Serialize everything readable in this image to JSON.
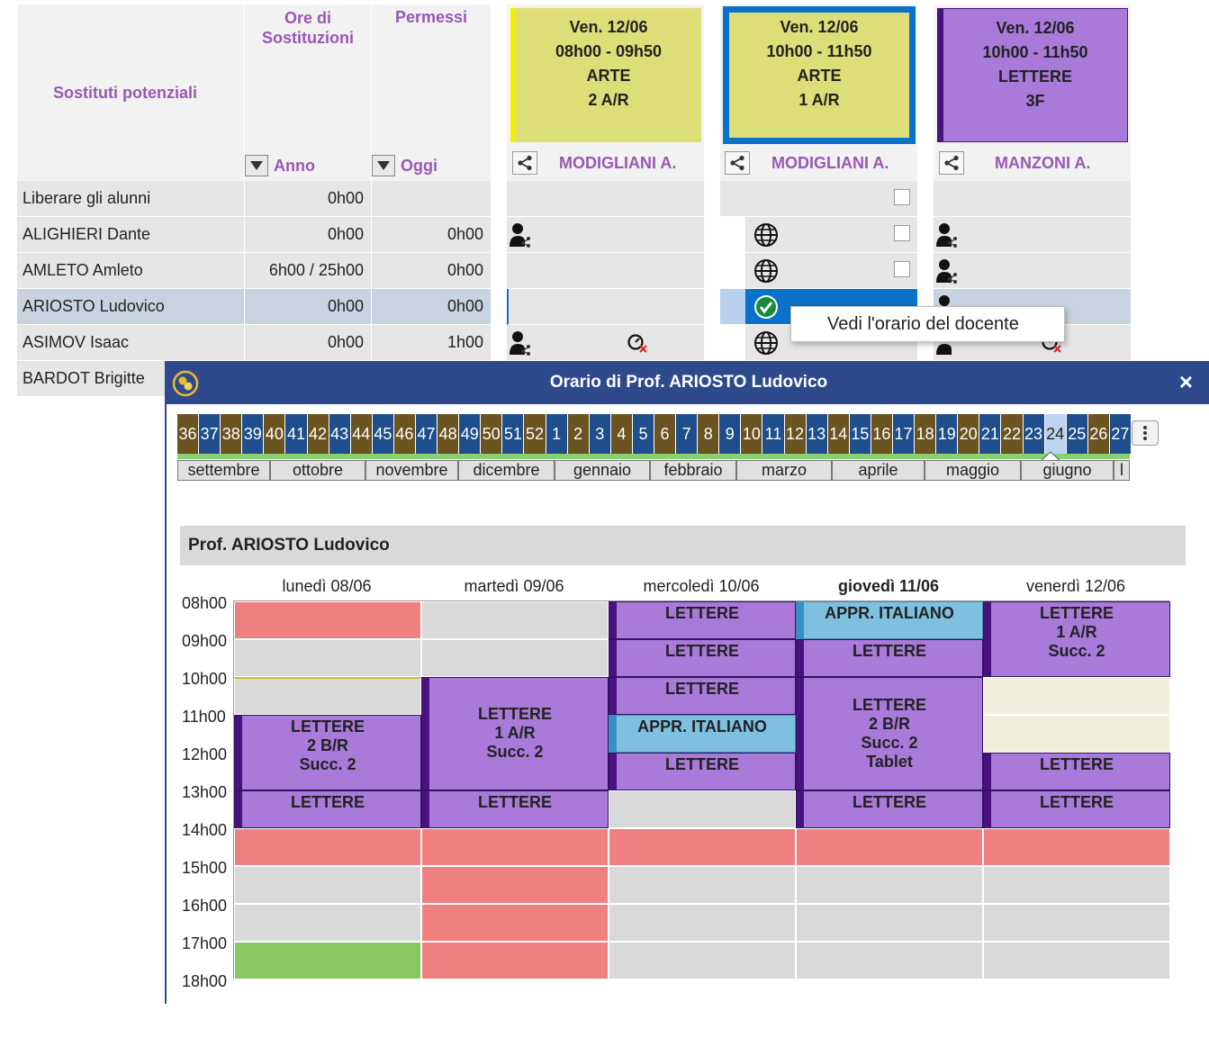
{
  "table": {
    "col_headers": {
      "potential": "Sostituti potenziali",
      "ore": "Ore di Sostituzioni",
      "permessi": "Permessi",
      "anno": "Anno",
      "oggi": "Oggi"
    },
    "courses": [
      {
        "line1": "Ven. 12/06",
        "line2": "08h00 - 09h50",
        "line3": "ARTE",
        "line4": "2 A/R",
        "teacher": "MODIGLIANI A.",
        "color": "#dede78"
      },
      {
        "line1": "Ven. 12/06",
        "line2": "10h00 - 11h50",
        "line3": "ARTE",
        "line4": "1 A/R",
        "teacher": "MODIGLIANI A.",
        "color": "#dede78"
      },
      {
        "line1": "Ven. 12/06",
        "line2": "10h00 - 11h50",
        "line3": "LETTERE",
        "line4": "3F",
        "teacher": "MANZONI A.",
        "color": "#a97ad9"
      }
    ],
    "rows": [
      {
        "name": "Liberare gli alunni",
        "anno": "0h00",
        "oggi": ""
      },
      {
        "name": "ALIGHIERI Dante",
        "anno": "0h00",
        "oggi": "0h00"
      },
      {
        "name": "AMLETO Amleto",
        "anno": "6h00 / 25h00",
        "oggi": "0h00"
      },
      {
        "name": "ARIOSTO Ludovico",
        "anno": "0h00",
        "oggi": "0h00"
      },
      {
        "name": "ASIMOV Isaac",
        "anno": "0h00",
        "oggi": "1h00"
      },
      {
        "name": "BARDOT Brigitte",
        "anno": "",
        "oggi": ""
      }
    ]
  },
  "context_menu": {
    "item": "Vedi l'orario del docente"
  },
  "modal": {
    "title": "Orario di Prof. ARIOSTO Ludovico",
    "close_glyph": "×",
    "weeks": [
      "36",
      "37",
      "38",
      "39",
      "40",
      "41",
      "42",
      "43",
      "44",
      "45",
      "46",
      "47",
      "48",
      "49",
      "50",
      "51",
      "52",
      "1",
      "2",
      "3",
      "4",
      "5",
      "6",
      "7",
      "8",
      "9",
      "10",
      "11",
      "12",
      "13",
      "14",
      "15",
      "16",
      "17",
      "18",
      "19",
      "20",
      "21",
      "22",
      "23",
      "24",
      "25",
      "26",
      "27"
    ],
    "selected_week": "24",
    "months": [
      "settembre",
      "ottobre",
      "novembre",
      "dicembre",
      "gennaio",
      "febbraio",
      "marzo",
      "aprile",
      "maggio",
      "giugno",
      "l"
    ],
    "timetable_title": "Prof. ARIOSTO Ludovico",
    "days": [
      "lunedì 08/06",
      "martedì 09/06",
      "mercoledì 10/06",
      "giovedì 11/06",
      "venerdì 12/06"
    ],
    "today_day": "giovedì 11/06",
    "hours": [
      "08h00",
      "09h00",
      "10h00",
      "11h00",
      "12h00",
      "13h00",
      "14h00",
      "15h00",
      "16h00",
      "17h00",
      "18h00"
    ],
    "lessons": {
      "mon_1": [
        "LETTERE",
        "2 B/R",
        "Succ. 2"
      ],
      "mon_2": [
        "LETTERE"
      ],
      "tue_1": [
        "LETTERE",
        "1 A/R",
        "Succ. 2"
      ],
      "tue_2": [
        "LETTERE"
      ],
      "wed_1": [
        "LETTERE"
      ],
      "wed_2": [
        "LETTERE"
      ],
      "wed_3": [
        "LETTERE"
      ],
      "wed_4": [
        "APPR. ITALIANO"
      ],
      "wed_5": [
        "LETTERE"
      ],
      "thu_1": [
        "APPR. ITALIANO"
      ],
      "thu_2": [
        "LETTERE"
      ],
      "thu_3": [
        "LETTERE",
        "2 B/R",
        "Succ. 2",
        "Tablet"
      ],
      "thu_4": [
        "LETTERE"
      ],
      "fri_1": [
        "LETTERE",
        "1 A/R",
        "Succ. 2"
      ],
      "fri_2": [
        "LETTERE"
      ],
      "fri_3": [
        "LETTERE"
      ]
    },
    "colors": {
      "week_brown": "#6b5420",
      "week_blue": "#1f4e8c",
      "lesson": "#a97ad9",
      "appr": "#7fc0e0",
      "break": "#f08080",
      "free_green": "#88c860"
    }
  }
}
